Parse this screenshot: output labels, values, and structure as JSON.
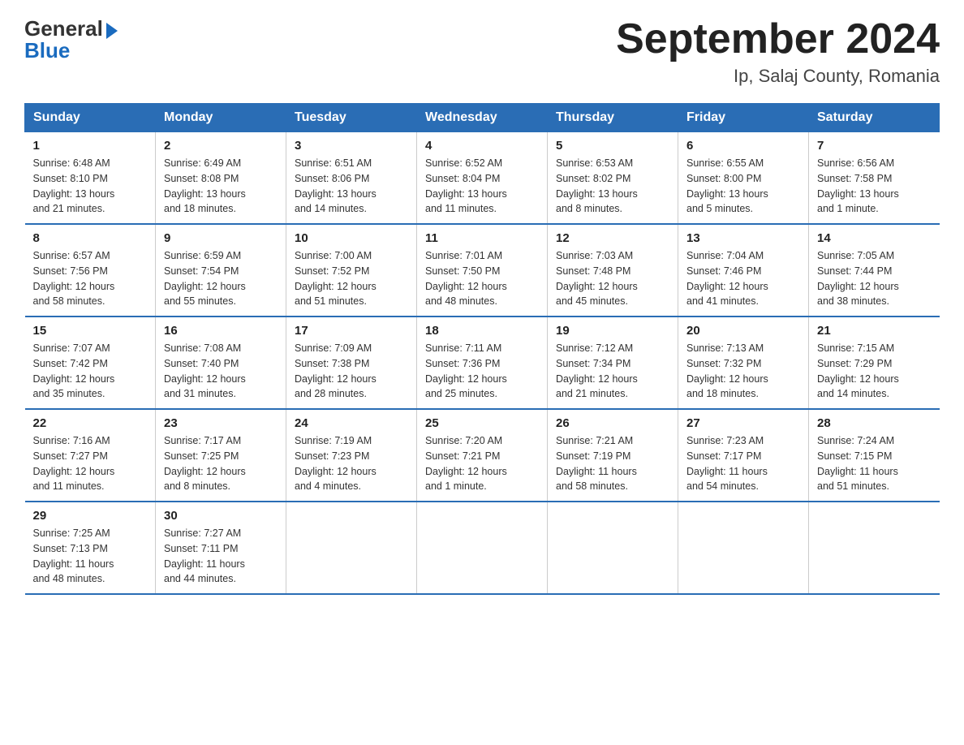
{
  "logo": {
    "general": "General",
    "blue": "Blue"
  },
  "title": {
    "month_year": "September 2024",
    "location": "Ip, Salaj County, Romania"
  },
  "headers": [
    "Sunday",
    "Monday",
    "Tuesday",
    "Wednesday",
    "Thursday",
    "Friday",
    "Saturday"
  ],
  "weeks": [
    [
      {
        "day": "1",
        "info": "Sunrise: 6:48 AM\nSunset: 8:10 PM\nDaylight: 13 hours\nand 21 minutes."
      },
      {
        "day": "2",
        "info": "Sunrise: 6:49 AM\nSunset: 8:08 PM\nDaylight: 13 hours\nand 18 minutes."
      },
      {
        "day": "3",
        "info": "Sunrise: 6:51 AM\nSunset: 8:06 PM\nDaylight: 13 hours\nand 14 minutes."
      },
      {
        "day": "4",
        "info": "Sunrise: 6:52 AM\nSunset: 8:04 PM\nDaylight: 13 hours\nand 11 minutes."
      },
      {
        "day": "5",
        "info": "Sunrise: 6:53 AM\nSunset: 8:02 PM\nDaylight: 13 hours\nand 8 minutes."
      },
      {
        "day": "6",
        "info": "Sunrise: 6:55 AM\nSunset: 8:00 PM\nDaylight: 13 hours\nand 5 minutes."
      },
      {
        "day": "7",
        "info": "Sunrise: 6:56 AM\nSunset: 7:58 PM\nDaylight: 13 hours\nand 1 minute."
      }
    ],
    [
      {
        "day": "8",
        "info": "Sunrise: 6:57 AM\nSunset: 7:56 PM\nDaylight: 12 hours\nand 58 minutes."
      },
      {
        "day": "9",
        "info": "Sunrise: 6:59 AM\nSunset: 7:54 PM\nDaylight: 12 hours\nand 55 minutes."
      },
      {
        "day": "10",
        "info": "Sunrise: 7:00 AM\nSunset: 7:52 PM\nDaylight: 12 hours\nand 51 minutes."
      },
      {
        "day": "11",
        "info": "Sunrise: 7:01 AM\nSunset: 7:50 PM\nDaylight: 12 hours\nand 48 minutes."
      },
      {
        "day": "12",
        "info": "Sunrise: 7:03 AM\nSunset: 7:48 PM\nDaylight: 12 hours\nand 45 minutes."
      },
      {
        "day": "13",
        "info": "Sunrise: 7:04 AM\nSunset: 7:46 PM\nDaylight: 12 hours\nand 41 minutes."
      },
      {
        "day": "14",
        "info": "Sunrise: 7:05 AM\nSunset: 7:44 PM\nDaylight: 12 hours\nand 38 minutes."
      }
    ],
    [
      {
        "day": "15",
        "info": "Sunrise: 7:07 AM\nSunset: 7:42 PM\nDaylight: 12 hours\nand 35 minutes."
      },
      {
        "day": "16",
        "info": "Sunrise: 7:08 AM\nSunset: 7:40 PM\nDaylight: 12 hours\nand 31 minutes."
      },
      {
        "day": "17",
        "info": "Sunrise: 7:09 AM\nSunset: 7:38 PM\nDaylight: 12 hours\nand 28 minutes."
      },
      {
        "day": "18",
        "info": "Sunrise: 7:11 AM\nSunset: 7:36 PM\nDaylight: 12 hours\nand 25 minutes."
      },
      {
        "day": "19",
        "info": "Sunrise: 7:12 AM\nSunset: 7:34 PM\nDaylight: 12 hours\nand 21 minutes."
      },
      {
        "day": "20",
        "info": "Sunrise: 7:13 AM\nSunset: 7:32 PM\nDaylight: 12 hours\nand 18 minutes."
      },
      {
        "day": "21",
        "info": "Sunrise: 7:15 AM\nSunset: 7:29 PM\nDaylight: 12 hours\nand 14 minutes."
      }
    ],
    [
      {
        "day": "22",
        "info": "Sunrise: 7:16 AM\nSunset: 7:27 PM\nDaylight: 12 hours\nand 11 minutes."
      },
      {
        "day": "23",
        "info": "Sunrise: 7:17 AM\nSunset: 7:25 PM\nDaylight: 12 hours\nand 8 minutes."
      },
      {
        "day": "24",
        "info": "Sunrise: 7:19 AM\nSunset: 7:23 PM\nDaylight: 12 hours\nand 4 minutes."
      },
      {
        "day": "25",
        "info": "Sunrise: 7:20 AM\nSunset: 7:21 PM\nDaylight: 12 hours\nand 1 minute."
      },
      {
        "day": "26",
        "info": "Sunrise: 7:21 AM\nSunset: 7:19 PM\nDaylight: 11 hours\nand 58 minutes."
      },
      {
        "day": "27",
        "info": "Sunrise: 7:23 AM\nSunset: 7:17 PM\nDaylight: 11 hours\nand 54 minutes."
      },
      {
        "day": "28",
        "info": "Sunrise: 7:24 AM\nSunset: 7:15 PM\nDaylight: 11 hours\nand 51 minutes."
      }
    ],
    [
      {
        "day": "29",
        "info": "Sunrise: 7:25 AM\nSunset: 7:13 PM\nDaylight: 11 hours\nand 48 minutes."
      },
      {
        "day": "30",
        "info": "Sunrise: 7:27 AM\nSunset: 7:11 PM\nDaylight: 11 hours\nand 44 minutes."
      },
      {
        "day": "",
        "info": ""
      },
      {
        "day": "",
        "info": ""
      },
      {
        "day": "",
        "info": ""
      },
      {
        "day": "",
        "info": ""
      },
      {
        "day": "",
        "info": ""
      }
    ]
  ]
}
